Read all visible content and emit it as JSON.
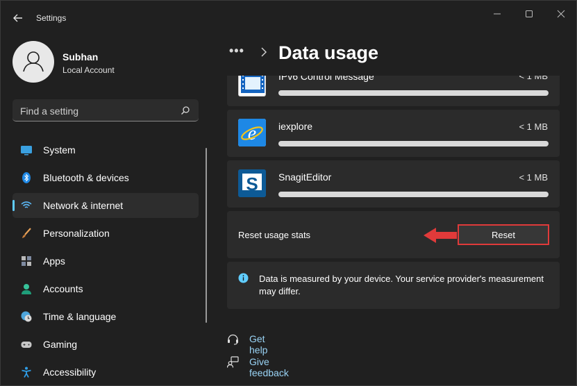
{
  "window": {
    "title": "Settings",
    "controls": [
      "minimize",
      "maximize",
      "close"
    ]
  },
  "profile": {
    "name": "Subhan",
    "account_type": "Local Account"
  },
  "search": {
    "placeholder": "Find a setting"
  },
  "sidebar": {
    "items": [
      {
        "label": "System",
        "icon": "system-icon"
      },
      {
        "label": "Bluetooth & devices",
        "icon": "bluetooth-icon"
      },
      {
        "label": "Network & internet",
        "icon": "wifi-icon",
        "active": true
      },
      {
        "label": "Personalization",
        "icon": "brush-icon"
      },
      {
        "label": "Apps",
        "icon": "apps-icon"
      },
      {
        "label": "Accounts",
        "icon": "person-icon"
      },
      {
        "label": "Time & language",
        "icon": "globe-clock-icon"
      },
      {
        "label": "Gaming",
        "icon": "gamepad-icon"
      },
      {
        "label": "Accessibility",
        "icon": "accessibility-icon"
      }
    ]
  },
  "breadcrumb": {
    "overflow": "•••",
    "page_title": "Data usage"
  },
  "apps": [
    {
      "name": "IPv6 Control Message",
      "usage": "< 1 MB",
      "icon": "film-strip-icon"
    },
    {
      "name": "iexplore",
      "usage": "< 1 MB",
      "icon": "internet-explorer-icon"
    },
    {
      "name": "SnagitEditor",
      "usage": "< 1 MB",
      "icon": "snagit-icon"
    }
  ],
  "reset": {
    "label": "Reset usage stats",
    "button": "Reset"
  },
  "info": {
    "text": "Data is measured by your device. Your service provider's measurement may differ."
  },
  "links": {
    "help": "Get help",
    "feedback": "Give feedback"
  },
  "colors": {
    "accent": "#60cdff",
    "link": "#99d3f5",
    "highlight": "#e03a3a"
  }
}
